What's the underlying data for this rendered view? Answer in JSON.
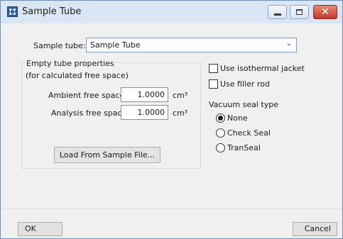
{
  "window": {
    "title": "Sample Tube"
  },
  "sample_tube": {
    "label": "Sample tube:",
    "value": "Sample Tube"
  },
  "empty_tube": {
    "title": "Empty tube properties",
    "subtitle": "(for calculated free space)",
    "ambient_label": "Ambient free space:",
    "ambient_value": "1.0000",
    "analysis_label": "Analysis free space:",
    "analysis_value": "1.0000",
    "unit": "cm³",
    "load_button": "Load From Sample File..."
  },
  "options": {
    "isothermal_jacket": {
      "label": "Use isothermal jacket",
      "checked": false
    },
    "filler_rod": {
      "label": "Use filler rod",
      "checked": false
    }
  },
  "vacuum_seal": {
    "title": "Vacuum seal type",
    "options": [
      "None",
      "Check Seal",
      "TranSeal"
    ],
    "selected": "None"
  },
  "buttons": {
    "ok": "OK",
    "cancel": "Cancel"
  }
}
